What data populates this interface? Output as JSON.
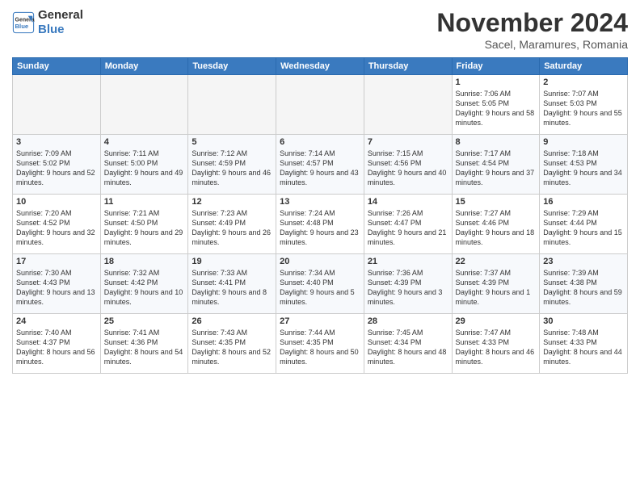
{
  "logo": {
    "line1": "General",
    "line2": "Blue"
  },
  "title": "November 2024",
  "subtitle": "Sacel, Maramures, Romania",
  "days_header": [
    "Sunday",
    "Monday",
    "Tuesday",
    "Wednesday",
    "Thursday",
    "Friday",
    "Saturday"
  ],
  "weeks": [
    [
      {
        "day": "",
        "info": ""
      },
      {
        "day": "",
        "info": ""
      },
      {
        "day": "",
        "info": ""
      },
      {
        "day": "",
        "info": ""
      },
      {
        "day": "",
        "info": ""
      },
      {
        "day": "1",
        "info": "Sunrise: 7:06 AM\nSunset: 5:05 PM\nDaylight: 9 hours and 58 minutes."
      },
      {
        "day": "2",
        "info": "Sunrise: 7:07 AM\nSunset: 5:03 PM\nDaylight: 9 hours and 55 minutes."
      }
    ],
    [
      {
        "day": "3",
        "info": "Sunrise: 7:09 AM\nSunset: 5:02 PM\nDaylight: 9 hours and 52 minutes."
      },
      {
        "day": "4",
        "info": "Sunrise: 7:11 AM\nSunset: 5:00 PM\nDaylight: 9 hours and 49 minutes."
      },
      {
        "day": "5",
        "info": "Sunrise: 7:12 AM\nSunset: 4:59 PM\nDaylight: 9 hours and 46 minutes."
      },
      {
        "day": "6",
        "info": "Sunrise: 7:14 AM\nSunset: 4:57 PM\nDaylight: 9 hours and 43 minutes."
      },
      {
        "day": "7",
        "info": "Sunrise: 7:15 AM\nSunset: 4:56 PM\nDaylight: 9 hours and 40 minutes."
      },
      {
        "day": "8",
        "info": "Sunrise: 7:17 AM\nSunset: 4:54 PM\nDaylight: 9 hours and 37 minutes."
      },
      {
        "day": "9",
        "info": "Sunrise: 7:18 AM\nSunset: 4:53 PM\nDaylight: 9 hours and 34 minutes."
      }
    ],
    [
      {
        "day": "10",
        "info": "Sunrise: 7:20 AM\nSunset: 4:52 PM\nDaylight: 9 hours and 32 minutes."
      },
      {
        "day": "11",
        "info": "Sunrise: 7:21 AM\nSunset: 4:50 PM\nDaylight: 9 hours and 29 minutes."
      },
      {
        "day": "12",
        "info": "Sunrise: 7:23 AM\nSunset: 4:49 PM\nDaylight: 9 hours and 26 minutes."
      },
      {
        "day": "13",
        "info": "Sunrise: 7:24 AM\nSunset: 4:48 PM\nDaylight: 9 hours and 23 minutes."
      },
      {
        "day": "14",
        "info": "Sunrise: 7:26 AM\nSunset: 4:47 PM\nDaylight: 9 hours and 21 minutes."
      },
      {
        "day": "15",
        "info": "Sunrise: 7:27 AM\nSunset: 4:46 PM\nDaylight: 9 hours and 18 minutes."
      },
      {
        "day": "16",
        "info": "Sunrise: 7:29 AM\nSunset: 4:44 PM\nDaylight: 9 hours and 15 minutes."
      }
    ],
    [
      {
        "day": "17",
        "info": "Sunrise: 7:30 AM\nSunset: 4:43 PM\nDaylight: 9 hours and 13 minutes."
      },
      {
        "day": "18",
        "info": "Sunrise: 7:32 AM\nSunset: 4:42 PM\nDaylight: 9 hours and 10 minutes."
      },
      {
        "day": "19",
        "info": "Sunrise: 7:33 AM\nSunset: 4:41 PM\nDaylight: 9 hours and 8 minutes."
      },
      {
        "day": "20",
        "info": "Sunrise: 7:34 AM\nSunset: 4:40 PM\nDaylight: 9 hours and 5 minutes."
      },
      {
        "day": "21",
        "info": "Sunrise: 7:36 AM\nSunset: 4:39 PM\nDaylight: 9 hours and 3 minutes."
      },
      {
        "day": "22",
        "info": "Sunrise: 7:37 AM\nSunset: 4:39 PM\nDaylight: 9 hours and 1 minute."
      },
      {
        "day": "23",
        "info": "Sunrise: 7:39 AM\nSunset: 4:38 PM\nDaylight: 8 hours and 59 minutes."
      }
    ],
    [
      {
        "day": "24",
        "info": "Sunrise: 7:40 AM\nSunset: 4:37 PM\nDaylight: 8 hours and 56 minutes."
      },
      {
        "day": "25",
        "info": "Sunrise: 7:41 AM\nSunset: 4:36 PM\nDaylight: 8 hours and 54 minutes."
      },
      {
        "day": "26",
        "info": "Sunrise: 7:43 AM\nSunset: 4:35 PM\nDaylight: 8 hours and 52 minutes."
      },
      {
        "day": "27",
        "info": "Sunrise: 7:44 AM\nSunset: 4:35 PM\nDaylight: 8 hours and 50 minutes."
      },
      {
        "day": "28",
        "info": "Sunrise: 7:45 AM\nSunset: 4:34 PM\nDaylight: 8 hours and 48 minutes."
      },
      {
        "day": "29",
        "info": "Sunrise: 7:47 AM\nSunset: 4:33 PM\nDaylight: 8 hours and 46 minutes."
      },
      {
        "day": "30",
        "info": "Sunrise: 7:48 AM\nSunset: 4:33 PM\nDaylight: 8 hours and 44 minutes."
      }
    ]
  ]
}
